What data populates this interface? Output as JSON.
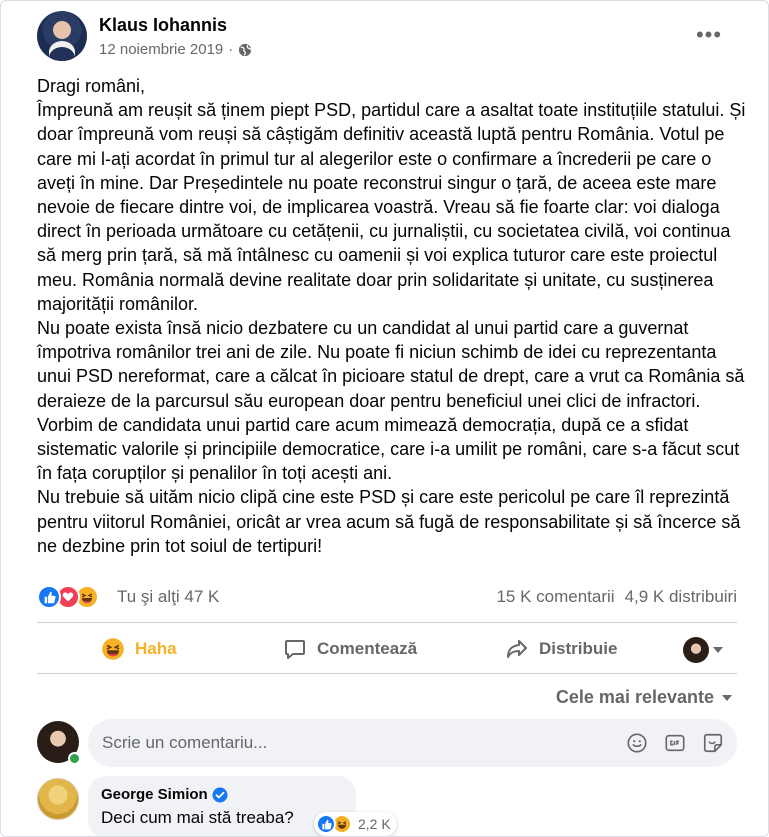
{
  "post": {
    "author": "Klaus Iohannis",
    "date": "12 noiembrie 2019",
    "separator": "·",
    "more_label": "•••",
    "paragraphs": [
      "Dragi români,",
      "Împreună am reușit să ținem piept PSD, partidul care a asaltat toate instituțiile statului. Și doar împreună vom reuși să câștigăm definitiv această luptă pentru România. Votul pe care mi l-ați acordat în primul tur al alegerilor este o confirmare a încrederii pe care o aveți în mine. Dar Președintele nu poate reconstrui singur o țară, de aceea este mare nevoie de fiecare dintre voi, de implicarea voastră. Vreau să fie foarte clar: voi dialoga direct în perioada următoare cu cetățenii, cu jurnaliștii, cu societatea civilă, voi continua să merg prin țară, să mă întâlnesc cu oamenii și voi explica tuturor care este proiectul meu. România normală devine realitate doar prin solidaritate și unitate, cu susținerea majorității românilor.",
      "Nu poate exista însă nicio dezbatere cu un candidat al unui partid care a guvernat împotriva românilor trei ani de zile. Nu poate fi niciun schimb de idei cu reprezentanta unui PSD nereformat, care a călcat în picioare statul de drept, care a vrut ca România să deraieze de la parcursul său european doar pentru beneficiul unei clici de infractori. Vorbim de candidata unui partid care acum mimează democrația, după ce a sfidat sistematic valorile și principiile democratice, care i-a umilit pe români, care s-a făcut scut în fața corupților și penalilor în toți acești ani.",
      "Nu trebuie să uităm nicio clipă cine este PSD și care este pericolul pe care îl reprezintă pentru viitorul României, oricât ar vrea acum să fugă de responsabilitate și să încerce să ne dezbine prin tot soiul de tertipuri!"
    ]
  },
  "engagement": {
    "reactions_text": "Tu şi alţi 47 K",
    "comments": "15 K comentarii",
    "shares": "4,9 K distribuiri",
    "reaction_icons": [
      "like-icon",
      "love-icon",
      "haha-icon"
    ]
  },
  "actions": {
    "haha": "Haha",
    "comment": "Comentează",
    "share": "Distribuie"
  },
  "sort": {
    "label": "Cele mai relevante"
  },
  "composer": {
    "placeholder": "Scrie un comentariu..."
  },
  "comments": [
    {
      "author": "George Simion",
      "text": "Deci cum mai stă treaba?",
      "reaction_count": "2,2 K"
    }
  ],
  "colors": {
    "accent": "#1877f2",
    "haha": "#f7b125",
    "love": "#f33e58",
    "secondary_text": "#65676b",
    "online": "#31a24c"
  }
}
